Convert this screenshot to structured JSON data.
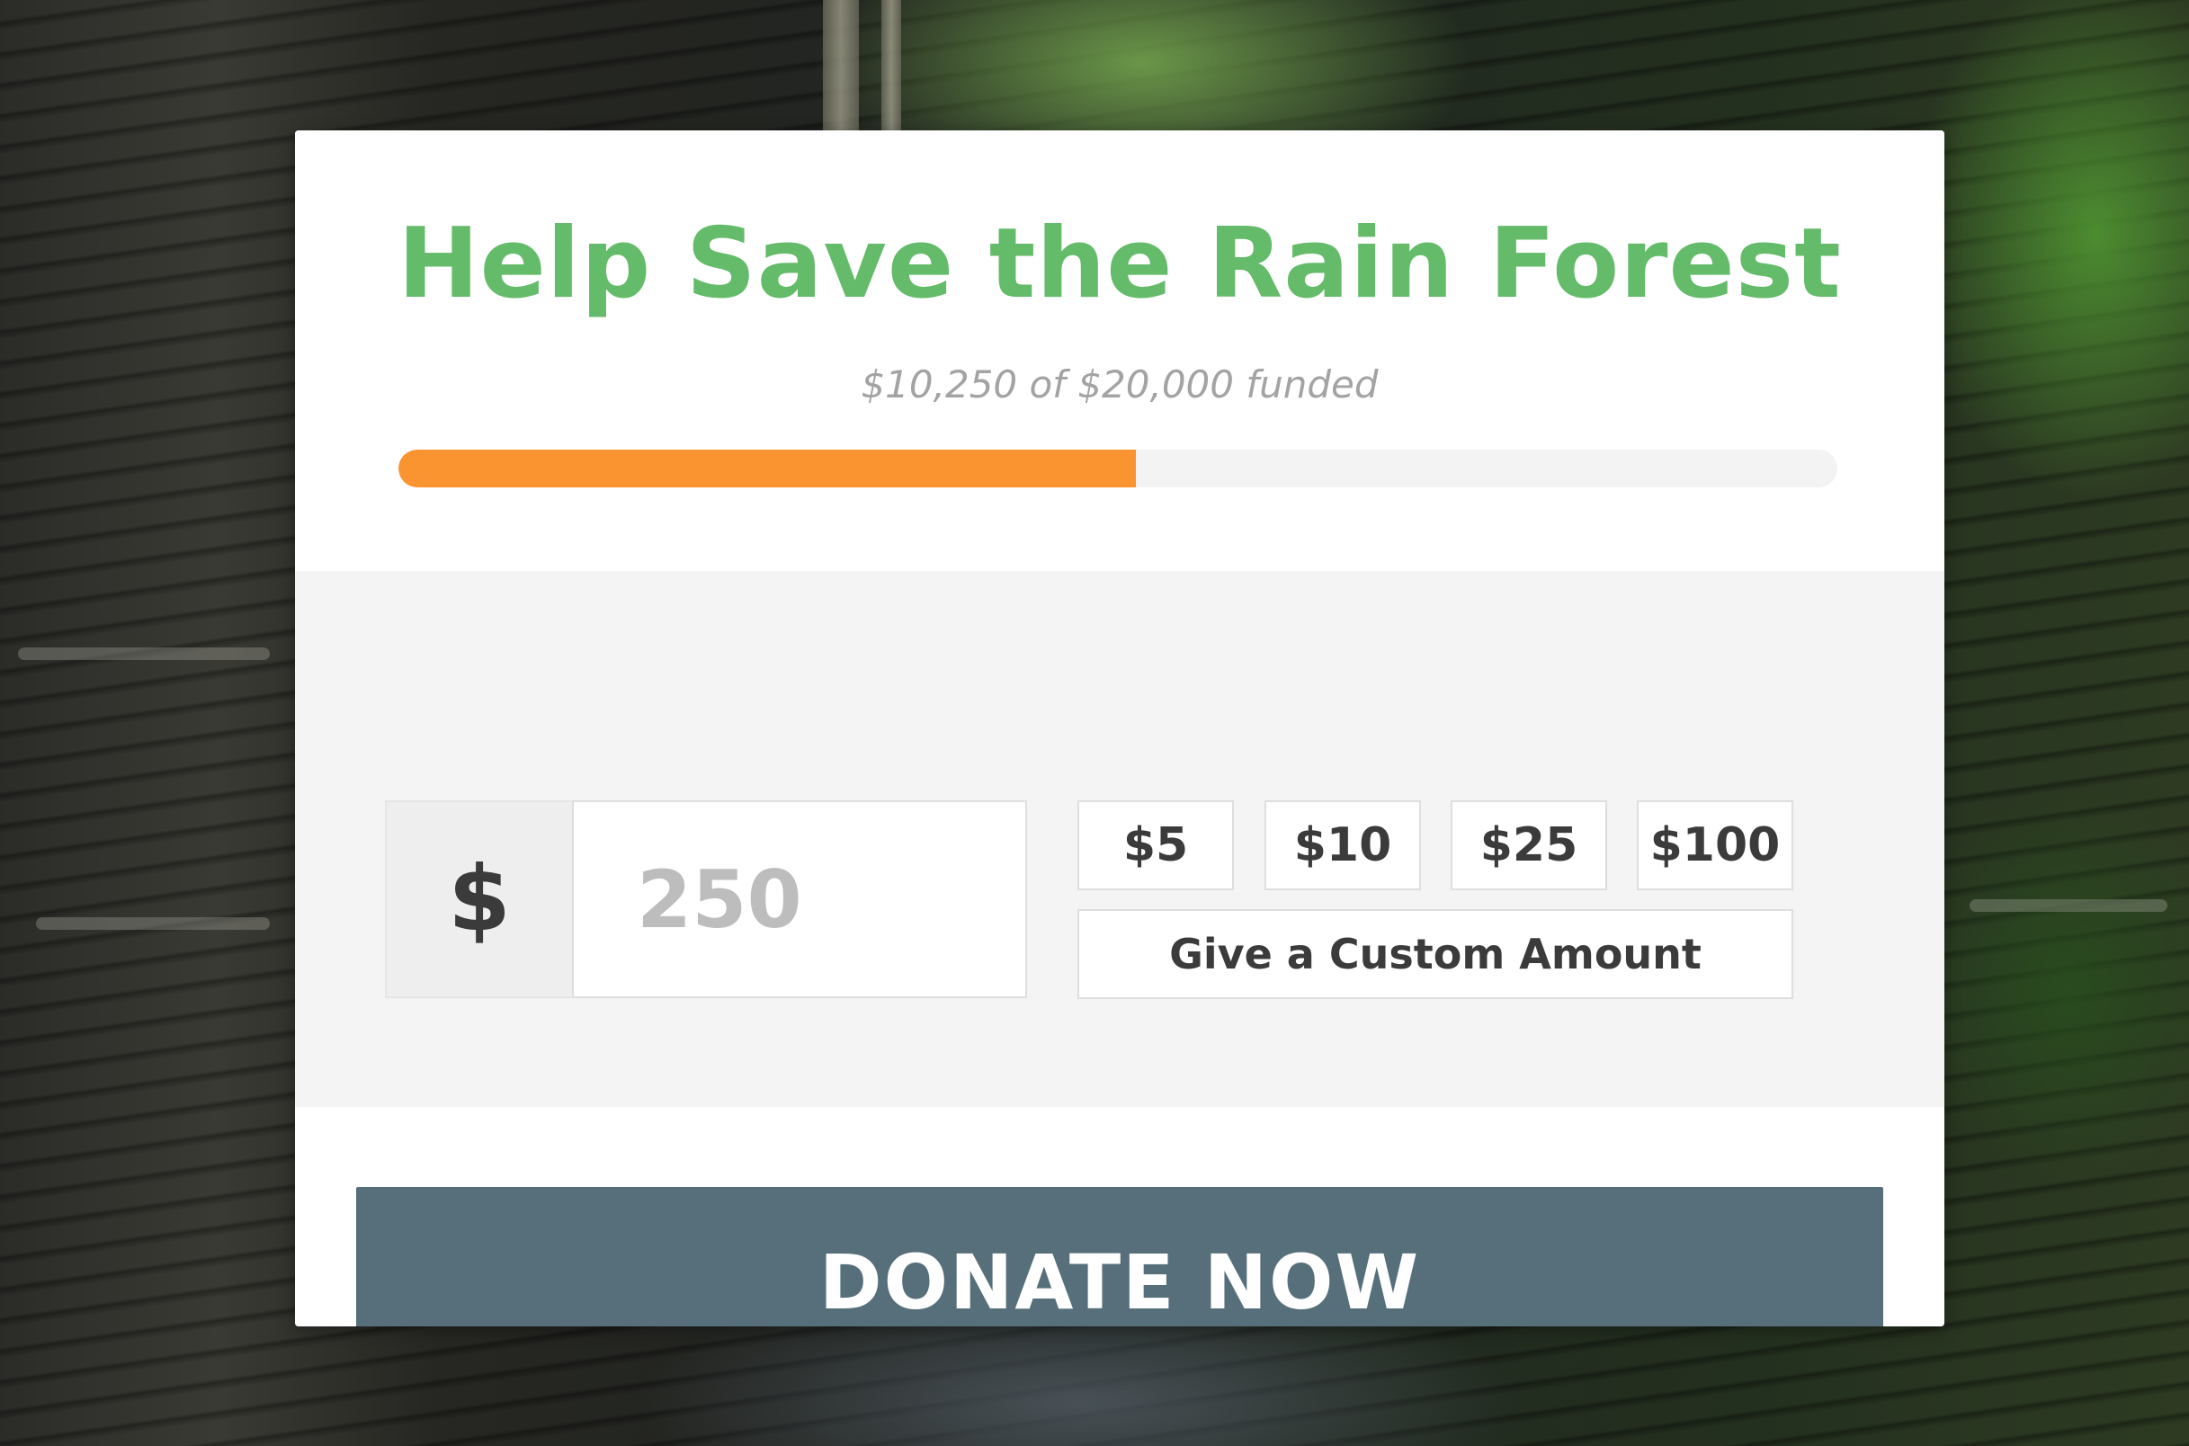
{
  "campaign": {
    "title": "Help Save the Rain Forest",
    "funded_text": "$10,250 of $20,000 funded",
    "progress_fraction": 0.5125
  },
  "donation": {
    "currency_symbol": "$",
    "amount_placeholder": "250",
    "presets": [
      "$5",
      "$10",
      "$25",
      "$100"
    ],
    "custom_label": "Give a Custom Amount"
  },
  "cta": {
    "donate_label": "DONATE NOW"
  },
  "colors": {
    "title": "#64bb6a",
    "progress": "#f99431",
    "button": "#566f7a"
  }
}
